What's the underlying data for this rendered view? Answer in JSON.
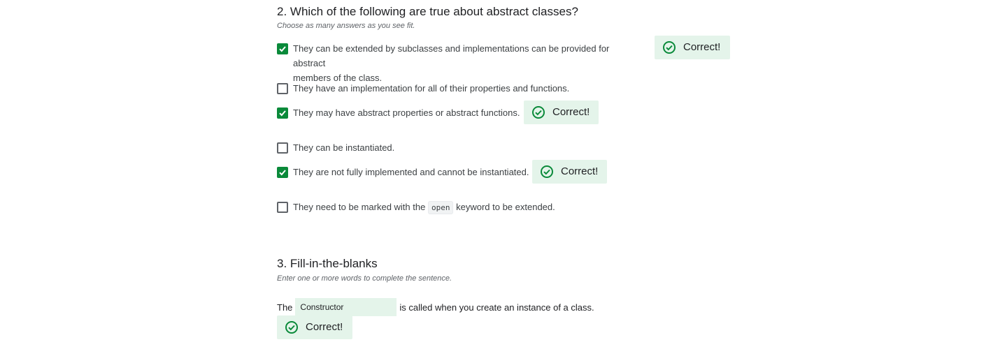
{
  "question2": {
    "title": "2. Which of the following are true about abstract classes?",
    "subtitle": "Choose as many answers as you see fit.",
    "options": [
      {
        "text_line1": "They can be extended by subclasses and implementations can be provided for abstract",
        "text_line2": "members of the class.",
        "checked": true,
        "feedback": "Correct!"
      },
      {
        "text": "They have an implementation for all of their properties and functions.",
        "checked": false
      },
      {
        "text": "They may have abstract properties or abstract functions.",
        "checked": true,
        "feedback": "Correct!"
      },
      {
        "text": "They can be instantiated.",
        "checked": false
      },
      {
        "text": "They are not fully implemented and cannot be instantiated.",
        "checked": true,
        "feedback": "Correct!"
      },
      {
        "text_before": "They need to be marked with the",
        "code": "open",
        "text_after": "keyword to be extended.",
        "checked": false
      }
    ]
  },
  "question3": {
    "title": "3. Fill-in-the-blanks",
    "subtitle": "Enter one or more words to complete the sentence.",
    "prefix": "The",
    "answer": "Constructor",
    "suffix": "is called when you create an instance of a class.",
    "feedback": "Correct!"
  },
  "colors": {
    "checkbox_checked": "#0a8a3a",
    "feedback_bg": "#e4f4ea",
    "feedback_icon": "#0a8a3a"
  },
  "icons": {
    "checkbox_check": "check-icon",
    "feedback": "check-circle-icon"
  }
}
